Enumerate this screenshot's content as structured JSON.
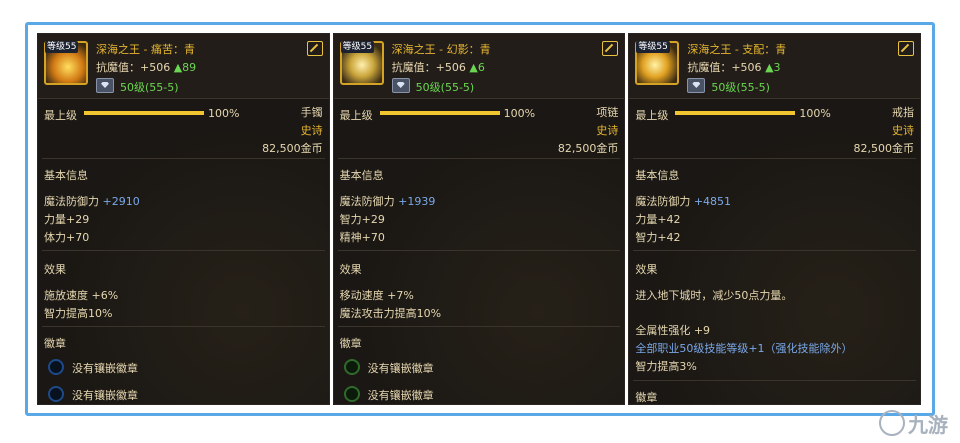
{
  "panels": [
    {
      "level_tag": "等级55",
      "title": "深海之王 - 痛苦：青",
      "resist_label": "抗魔值：+506",
      "resist_up": "▲89",
      "level_text": "50级(55-5)",
      "grade_label": "最上级",
      "grade_pct": "100%",
      "grade_fill": 1.0,
      "slot_type": "手镯",
      "rarity": "史诗",
      "price": "82,500金币",
      "basic_title": "基本信息",
      "basic_stat": "魔法防御力",
      "basic_stat_val": "+2910",
      "stat_lines": [
        "力量+29",
        "体力+70"
      ],
      "effect_title": "效果",
      "effect_lines": [
        "施放速度 +6%",
        "智力提高10%"
      ],
      "emblem_title": "徽章",
      "emblem_slots": [
        "没有镶嵌徽章",
        "没有镶嵌徽章"
      ],
      "ring_color": "blue"
    },
    {
      "level_tag": "等级55",
      "title": "深海之王 - 幻影：青",
      "resist_label": "抗魔值：+506",
      "resist_up": "▲6",
      "level_text": "50级(55-5)",
      "grade_label": "最上级",
      "grade_pct": "100%",
      "grade_fill": 1.0,
      "slot_type": "项链",
      "rarity": "史诗",
      "price": "82,500金币",
      "basic_title": "基本信息",
      "basic_stat": "魔法防御力",
      "basic_stat_val": "+1939",
      "stat_lines": [
        "智力+29",
        "精神+70"
      ],
      "effect_title": "效果",
      "effect_lines": [
        "移动速度 +7%",
        "魔法攻击力提高10%"
      ],
      "emblem_title": "徽章",
      "emblem_slots": [
        "没有镶嵌徽章",
        "没有镶嵌徽章"
      ],
      "ring_color": "green"
    },
    {
      "level_tag": "等级55",
      "title": "深海之王 - 支配：青",
      "resist_label": "抗魔值：+506",
      "resist_up": "▲3",
      "level_text": "50级(55-5)",
      "grade_label": "最上级",
      "grade_pct": "100%",
      "grade_fill": 1.0,
      "slot_type": "戒指",
      "rarity": "史诗",
      "price": "82,500金币",
      "basic_title": "基本信息",
      "basic_stat": "魔法防御力",
      "basic_stat_val": "+4851",
      "stat_lines": [
        "力量+42",
        "智力+42"
      ],
      "effect_title": "效果",
      "effect_lines": [
        "进入地下城时，减少50点力量。"
      ],
      "extra_lines": [
        "全属性强化 +9"
      ],
      "extra_blue": "全部职业50级技能等级+1（强化技能除外）",
      "extra_after": "智力提高3%",
      "emblem_title": "徽章",
      "emblem_slots": []
    }
  ],
  "watermark": "九游"
}
